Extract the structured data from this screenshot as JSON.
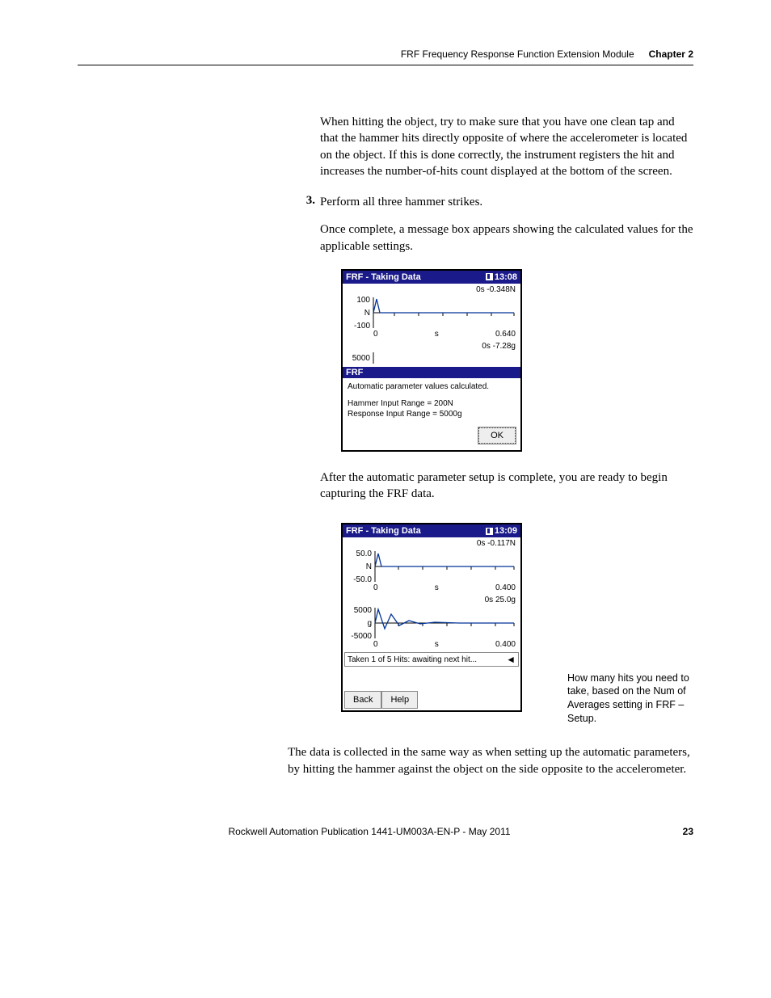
{
  "header": {
    "title": "FRF Frequency Response Function Extension Module",
    "chapter": "Chapter 2"
  },
  "para1": "When hitting the object, try to make sure that you have one clean tap and that the hammer hits directly opposite of where the accelerometer is located on the object. If this is done correctly, the instrument registers the hit and increases the number-of-hits count displayed at the bottom of the screen.",
  "step3_num": "3.",
  "step3_text": "Perform all three hammer strikes.",
  "para2": "Once complete, a message box appears showing the calculated values for the applicable settings.",
  "shot1": {
    "title": "FRF - Taking Data",
    "time": "13:08",
    "chart1": {
      "reading": "0s  -0.348N",
      "ymax": "100",
      "yunit": "N",
      "ymin": "-100",
      "x0": "0",
      "xlabel": "s",
      "xend": "0.640"
    },
    "chart2": {
      "reading": "0s  -7.28g",
      "ylabel": "5000"
    },
    "sub": "FRF",
    "msg_line1": "Automatic parameter values calculated.",
    "msg_line2": "Hammer Input Range = 200N",
    "msg_line3": "Response Input Range = 5000g",
    "ok": "OK"
  },
  "para3": "After the automatic parameter setup is complete, you are ready to begin capturing the FRF data.",
  "shot2": {
    "title": "FRF - Taking Data",
    "time": "13:09",
    "chart1": {
      "reading": "0s  -0.117N",
      "ymax": "50.0",
      "yunit": "N",
      "ymin": "-50.0",
      "x0": "0",
      "xlabel": "s",
      "xend": "0.400"
    },
    "chart2": {
      "reading": "0s  25.0g",
      "ymax": "5000",
      "yunit": "g",
      "ymin": "-5000",
      "x0": "0",
      "xlabel": "s",
      "xend": "0.400"
    },
    "status": "Taken 1 of 5 Hits: awaiting next hit...",
    "back": "Back",
    "help": "Help"
  },
  "annotation": "How many hits you need to take, based on the Num of Averages setting in FRF – Setup.",
  "para4": "The data is collected in the same way as when setting up the automatic parameters, by hitting the hammer against the object on the side opposite to the accelerometer.",
  "footer": {
    "pub": "Rockwell Automation Publication 1441-UM003A-EN-P - May 2011",
    "page": "23"
  },
  "chart_data": [
    {
      "type": "line",
      "title": "Hammer signal (screenshot 1)",
      "xlabel": "s",
      "ylabel": "N",
      "xlim": [
        0,
        0.64
      ],
      "ylim": [
        -100,
        100
      ],
      "series": [
        {
          "name": "N",
          "x": [
            0,
            0.02,
            0.04,
            0.64
          ],
          "values": [
            0,
            80,
            0,
            0
          ]
        }
      ],
      "cursor": {
        "x": 0,
        "value": -0.348,
        "unit": "N"
      }
    },
    {
      "type": "line",
      "title": "Response signal (screenshot 1, partial)",
      "ylabel": "g",
      "ylim_label_top": 5000,
      "cursor": {
        "x": 0,
        "value": -7.28,
        "unit": "g"
      }
    },
    {
      "type": "line",
      "title": "Hammer signal (screenshot 2)",
      "xlabel": "s",
      "ylabel": "N",
      "xlim": [
        0,
        0.4
      ],
      "ylim": [
        -50.0,
        50.0
      ],
      "series": [
        {
          "name": "N",
          "x": [
            0,
            0.015,
            0.03,
            0.4
          ],
          "values": [
            0,
            45,
            0,
            0
          ]
        }
      ],
      "cursor": {
        "x": 0,
        "value": -0.117,
        "unit": "N"
      }
    },
    {
      "type": "line",
      "title": "Response signal (screenshot 2)",
      "xlabel": "s",
      "ylabel": "g",
      "xlim": [
        0,
        0.4
      ],
      "ylim": [
        -5000,
        5000
      ],
      "series": [
        {
          "name": "g",
          "x": [
            0,
            0.02,
            0.06,
            0.12,
            0.2,
            0.3,
            0.4
          ],
          "values": [
            0,
            4500,
            1800,
            700,
            200,
            50,
            0
          ]
        }
      ],
      "cursor": {
        "x": 0,
        "value": 25.0,
        "unit": "g"
      }
    }
  ]
}
